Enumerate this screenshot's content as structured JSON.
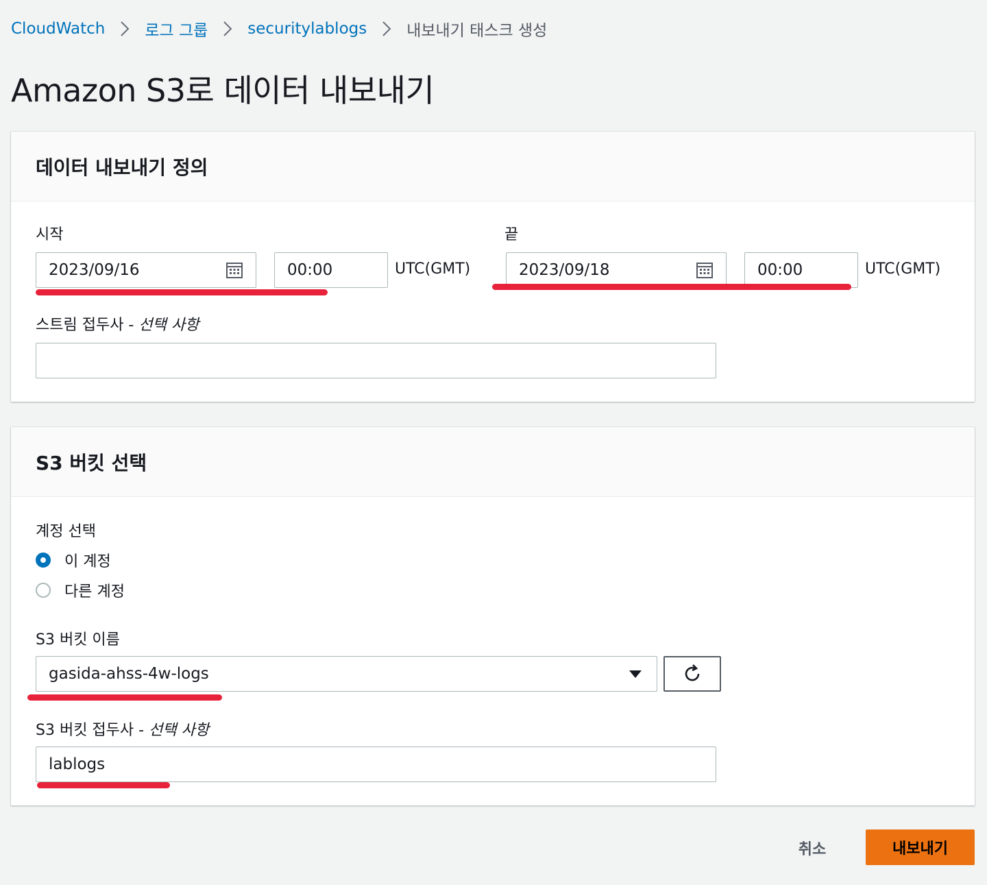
{
  "breadcrumb": {
    "items": [
      "CloudWatch",
      "로그 그룹",
      "securitylablogs"
    ],
    "current": "내보내기 태스크 생성"
  },
  "page_title": "Amazon S3로 데이터 내보내기",
  "define_panel": {
    "title": "데이터 내보내기 정의",
    "start": {
      "label": "시작",
      "date": "2023/09/16",
      "time": "00:00",
      "tz": "UTC(GMT)"
    },
    "end": {
      "label": "끝",
      "date": "2023/09/18",
      "time": "00:00",
      "tz": "UTC(GMT)"
    },
    "stream_prefix": {
      "label": "스트림 접두사 - ",
      "optional": "선택 사항",
      "value": ""
    }
  },
  "bucket_panel": {
    "title": "S3 버킷 선택",
    "account": {
      "label": "계정 선택",
      "options": [
        "이 계정",
        "다른 계정"
      ],
      "selected": "이 계정"
    },
    "bucket_name": {
      "label": "S3 버킷 이름",
      "value": "gasida-ahss-4w-logs"
    },
    "bucket_prefix": {
      "label": "S3 버킷 접두사 - ",
      "optional": "선택 사항",
      "value": "lablogs"
    }
  },
  "actions": {
    "cancel": "취소",
    "export": "내보내기"
  },
  "icons": {
    "calendar": "calendar-icon",
    "refresh": "refresh-icon",
    "caret": "caret-down-icon",
    "chevron": "chevron-right-icon"
  },
  "colors": {
    "link": "#0073bb",
    "primary": "#ec7211",
    "highlight": "#e8223b",
    "radio": "#0073bb"
  }
}
